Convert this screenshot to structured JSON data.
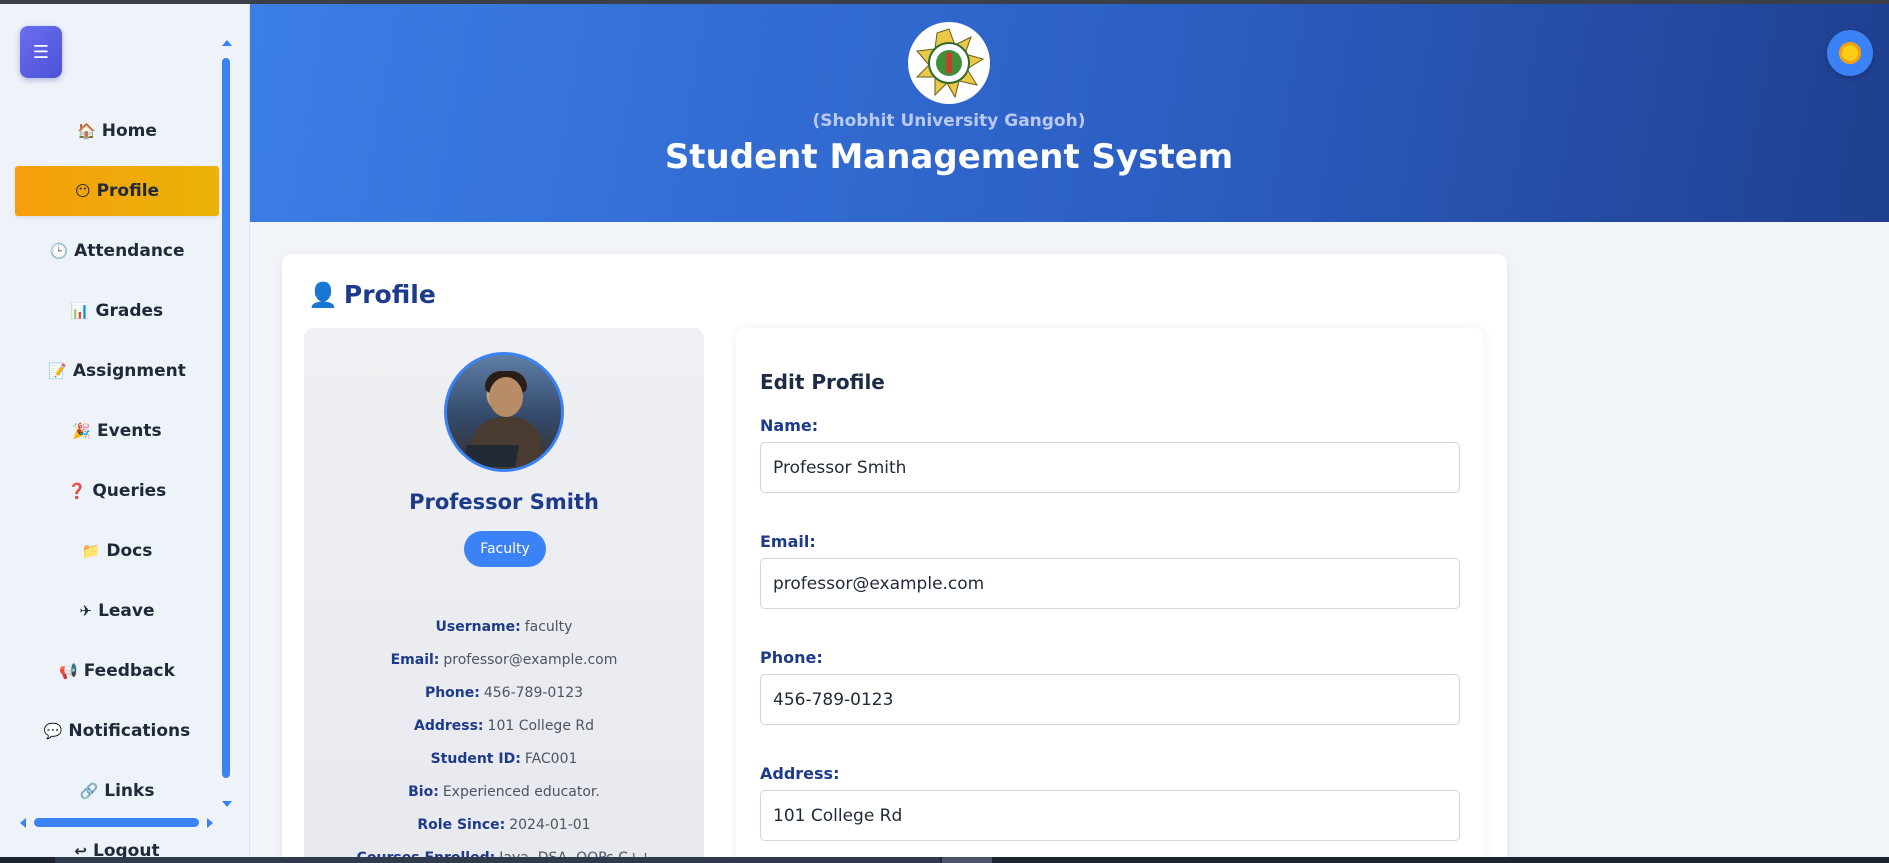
{
  "sidebar": {
    "toggle_icon": "☰",
    "items": [
      {
        "icon": "🏠",
        "label": "Home",
        "active": false
      },
      {
        "icon": "😶",
        "label": "Profile",
        "active": true
      },
      {
        "icon": "🕒",
        "label": "Attendance",
        "active": false
      },
      {
        "icon": "📊",
        "label": "Grades",
        "active": false
      },
      {
        "icon": "📝",
        "label": "Assignment",
        "active": false
      },
      {
        "icon": "🎉",
        "label": "Events",
        "active": false
      },
      {
        "icon": "❓",
        "label": "Queries",
        "active": false
      },
      {
        "icon": "📁",
        "label": "Docs",
        "active": false
      },
      {
        "icon": "✈",
        "label": "Leave",
        "active": false
      },
      {
        "icon": "📢",
        "label": "Feedback",
        "active": false
      },
      {
        "icon": "💬",
        "label": "Notifications",
        "active": false
      },
      {
        "icon": "🔗",
        "label": "Links",
        "active": false
      },
      {
        "icon": "↩",
        "label": "Logout",
        "active": false
      }
    ]
  },
  "header": {
    "university": "(Shobhit University Gangoh)",
    "title": "Student Management System",
    "logo_icon": "university-seal-icon",
    "theme_icon": "sun-icon"
  },
  "profile": {
    "section_icon": "👤",
    "section_title": "Profile",
    "name": "Professor Smith",
    "role": "Faculty",
    "details": [
      {
        "label": "Username:",
        "value": "faculty"
      },
      {
        "label": "Email:",
        "value": "professor@example.com"
      },
      {
        "label": "Phone:",
        "value": "456-789-0123"
      },
      {
        "label": "Address:",
        "value": "101 College Rd"
      },
      {
        "label": "Student ID:",
        "value": "FAC001"
      },
      {
        "label": "Bio:",
        "value": "Experienced educator."
      },
      {
        "label": "Role Since:",
        "value": "2024-01-01"
      },
      {
        "label": "Courses Enrolled:",
        "value": "Java, DSA, OOPs C++"
      }
    ]
  },
  "edit_profile": {
    "title": "Edit Profile",
    "fields": [
      {
        "label": "Name:",
        "value": "Professor Smith"
      },
      {
        "label": "Email:",
        "value": "professor@example.com"
      },
      {
        "label": "Phone:",
        "value": "456-789-0123"
      },
      {
        "label": "Address:",
        "value": "101 College Rd"
      }
    ]
  },
  "colors": {
    "accent": "#3b82f6",
    "active_nav": "#f59e0b",
    "header_start": "#3b7ee6",
    "header_end": "#1f3f8f",
    "heading": "#1e3a8a"
  }
}
